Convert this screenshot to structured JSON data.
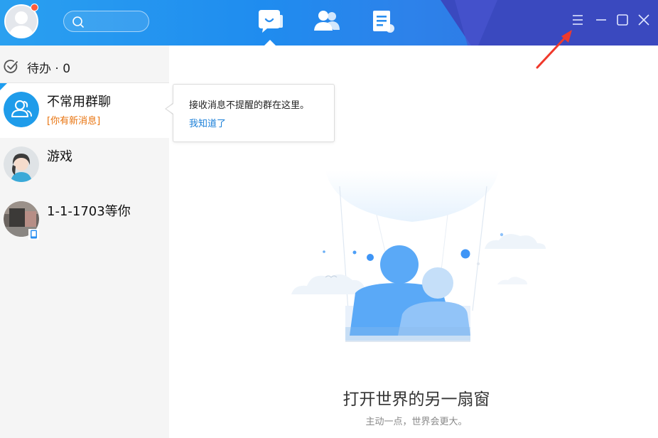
{
  "app": {
    "accent_color": "#1f8cef",
    "nav_tabs": [
      {
        "name": "messages",
        "icon": "chat-bubble-icon",
        "active": true
      },
      {
        "name": "contacts",
        "icon": "contacts-icon",
        "active": false
      },
      {
        "name": "docs",
        "icon": "document-icon",
        "active": false
      }
    ],
    "window_controls": [
      "menu-icon",
      "minimize-icon",
      "maximize-icon",
      "close-icon"
    ]
  },
  "search": {
    "placeholder": ""
  },
  "sidebar": {
    "todo_label": "待办 · 0",
    "chats": [
      {
        "name": "不常用群聊",
        "subtitle": "[你有新消息]",
        "icon": "group-icon",
        "selected": true
      },
      {
        "name": "游戏",
        "subtitle": "",
        "icon": "avatar-girl",
        "selected": false
      },
      {
        "name": "1-1-1703等你",
        "subtitle": "",
        "icon": "avatar-photo",
        "selected": false
      }
    ]
  },
  "tooltip": {
    "text": "接收消息不提醒的群在这里。",
    "link": "我知道了"
  },
  "main": {
    "title": "打开世界的另一扇窗",
    "subtitle": "主动一点，世界会更大。"
  }
}
